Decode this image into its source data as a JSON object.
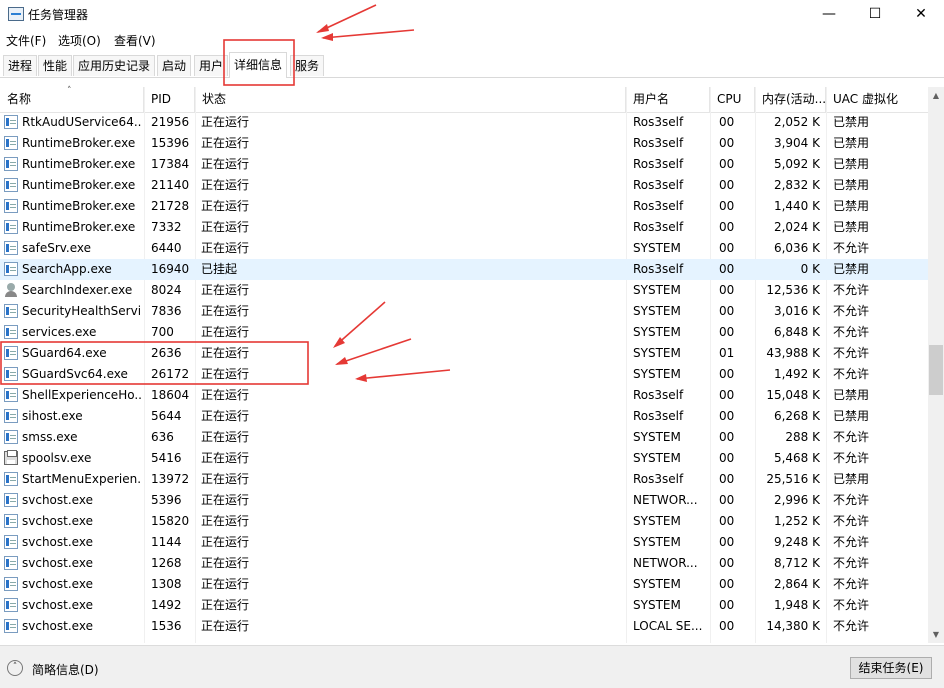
{
  "window": {
    "title": "任务管理器",
    "minimize": "—",
    "maximize": "☐",
    "close": "✕"
  },
  "menu": [
    "文件(F)",
    "选项(O)",
    "查看(V)"
  ],
  "tabs": [
    "进程",
    "性能",
    "应用历史记录",
    "启动",
    "用户",
    "详细信息",
    "服务"
  ],
  "active_tab_index": 5,
  "columns": [
    "名称",
    "PID",
    "状态",
    "用户名",
    "CPU",
    "内存(活动...",
    "UAC 虚拟化"
  ],
  "sort_indicator": "˄",
  "rows": [
    {
      "name": "RtkAudUService64....",
      "pid": "21956",
      "status": "正在运行",
      "user": "Ros3self",
      "cpu": "00",
      "mem": "2,052 K",
      "uac": "已禁用",
      "icon": "service-icon"
    },
    {
      "name": "RuntimeBroker.exe",
      "pid": "15396",
      "status": "正在运行",
      "user": "Ros3self",
      "cpu": "00",
      "mem": "3,904 K",
      "uac": "已禁用",
      "icon": "service-icon"
    },
    {
      "name": "RuntimeBroker.exe",
      "pid": "17384",
      "status": "正在运行",
      "user": "Ros3self",
      "cpu": "00",
      "mem": "5,092 K",
      "uac": "已禁用",
      "icon": "service-icon"
    },
    {
      "name": "RuntimeBroker.exe",
      "pid": "21140",
      "status": "正在运行",
      "user": "Ros3self",
      "cpu": "00",
      "mem": "2,832 K",
      "uac": "已禁用",
      "icon": "service-icon"
    },
    {
      "name": "RuntimeBroker.exe",
      "pid": "21728",
      "status": "正在运行",
      "user": "Ros3self",
      "cpu": "00",
      "mem": "1,440 K",
      "uac": "已禁用",
      "icon": "service-icon"
    },
    {
      "name": "RuntimeBroker.exe",
      "pid": "7332",
      "status": "正在运行",
      "user": "Ros3self",
      "cpu": "00",
      "mem": "2,024 K",
      "uac": "已禁用",
      "icon": "service-icon"
    },
    {
      "name": "safeSrv.exe",
      "pid": "6440",
      "status": "正在运行",
      "user": "SYSTEM",
      "cpu": "00",
      "mem": "6,036 K",
      "uac": "不允许",
      "icon": "service-icon"
    },
    {
      "name": "SearchApp.exe",
      "pid": "16940",
      "status": "已挂起",
      "user": "Ros3self",
      "cpu": "00",
      "mem": "0 K",
      "uac": "已禁用",
      "icon": "service-icon",
      "selected": true
    },
    {
      "name": "SearchIndexer.exe",
      "pid": "8024",
      "status": "正在运行",
      "user": "SYSTEM",
      "cpu": "00",
      "mem": "12,536 K",
      "uac": "不允许",
      "icon": "person-icon"
    },
    {
      "name": "SecurityHealthServi...",
      "pid": "7836",
      "status": "正在运行",
      "user": "SYSTEM",
      "cpu": "00",
      "mem": "3,016 K",
      "uac": "不允许",
      "icon": "service-icon"
    },
    {
      "name": "services.exe",
      "pid": "700",
      "status": "正在运行",
      "user": "SYSTEM",
      "cpu": "00",
      "mem": "6,848 K",
      "uac": "不允许",
      "icon": "service-icon"
    },
    {
      "name": "SGuard64.exe",
      "pid": "2636",
      "status": "正在运行",
      "user": "SYSTEM",
      "cpu": "01",
      "mem": "43,988 K",
      "uac": "不允许",
      "icon": "service-icon"
    },
    {
      "name": "SGuardSvc64.exe",
      "pid": "26172",
      "status": "正在运行",
      "user": "SYSTEM",
      "cpu": "00",
      "mem": "1,492 K",
      "uac": "不允许",
      "icon": "service-icon"
    },
    {
      "name": "ShellExperienceHo...",
      "pid": "18604",
      "status": "正在运行",
      "user": "Ros3self",
      "cpu": "00",
      "mem": "15,048 K",
      "uac": "已禁用",
      "icon": "service-icon"
    },
    {
      "name": "sihost.exe",
      "pid": "5644",
      "status": "正在运行",
      "user": "Ros3self",
      "cpu": "00",
      "mem": "6,268 K",
      "uac": "已禁用",
      "icon": "service-icon"
    },
    {
      "name": "smss.exe",
      "pid": "636",
      "status": "正在运行",
      "user": "SYSTEM",
      "cpu": "00",
      "mem": "288 K",
      "uac": "不允许",
      "icon": "service-icon"
    },
    {
      "name": "spoolsv.exe",
      "pid": "5416",
      "status": "正在运行",
      "user": "SYSTEM",
      "cpu": "00",
      "mem": "5,468 K",
      "uac": "不允许",
      "icon": "printer-icon"
    },
    {
      "name": "StartMenuExperien...",
      "pid": "13972",
      "status": "正在运行",
      "user": "Ros3self",
      "cpu": "00",
      "mem": "25,516 K",
      "uac": "已禁用",
      "icon": "service-icon"
    },
    {
      "name": "svchost.exe",
      "pid": "5396",
      "status": "正在运行",
      "user": "NETWOR...",
      "cpu": "00",
      "mem": "2,996 K",
      "uac": "不允许",
      "icon": "service-icon"
    },
    {
      "name": "svchost.exe",
      "pid": "15820",
      "status": "正在运行",
      "user": "SYSTEM",
      "cpu": "00",
      "mem": "1,252 K",
      "uac": "不允许",
      "icon": "service-icon"
    },
    {
      "name": "svchost.exe",
      "pid": "1144",
      "status": "正在运行",
      "user": "SYSTEM",
      "cpu": "00",
      "mem": "9,248 K",
      "uac": "不允许",
      "icon": "service-icon"
    },
    {
      "name": "svchost.exe",
      "pid": "1268",
      "status": "正在运行",
      "user": "NETWOR...",
      "cpu": "00",
      "mem": "8,712 K",
      "uac": "不允许",
      "icon": "service-icon"
    },
    {
      "name": "svchost.exe",
      "pid": "1308",
      "status": "正在运行",
      "user": "SYSTEM",
      "cpu": "00",
      "mem": "2,864 K",
      "uac": "不允许",
      "icon": "service-icon"
    },
    {
      "name": "svchost.exe",
      "pid": "1492",
      "status": "正在运行",
      "user": "SYSTEM",
      "cpu": "00",
      "mem": "1,948 K",
      "uac": "不允许",
      "icon": "service-icon"
    },
    {
      "name": "svchost.exe",
      "pid": "1536",
      "status": "正在运行",
      "user": "LOCAL SE...",
      "cpu": "00",
      "mem": "14,380 K",
      "uac": "不允许",
      "icon": "service-icon"
    }
  ],
  "footer": {
    "collapse_label": "简略信息(D)",
    "collapse_glyph": "˄",
    "end_task": "结束任务(E)"
  },
  "colors": {
    "selection": "#e5f3ff",
    "annotation": "#e53935"
  }
}
